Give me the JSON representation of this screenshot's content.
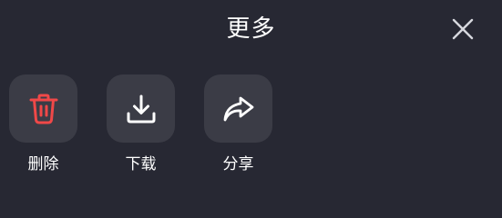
{
  "sheet": {
    "title": "更多",
    "close_icon": "close-icon"
  },
  "actions": [
    {
      "label": "删除",
      "icon": "trash-icon",
      "color": "#f04848"
    },
    {
      "label": "下载",
      "icon": "download-icon",
      "color": "#ffffff"
    },
    {
      "label": "分享",
      "icon": "share-icon",
      "color": "#ffffff"
    }
  ]
}
